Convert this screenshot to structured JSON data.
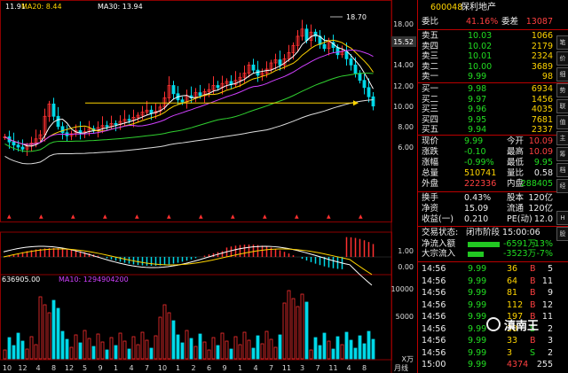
{
  "chart": {
    "ma_legend": {
      "ma1": "11.91",
      "ma20": "MA20: 8.44",
      "ma30": "MA30: 13.94"
    },
    "vol_legend": {
      "vol": "636905.00",
      "ma10": "MA10: 1294904200"
    },
    "price_axis": [
      "18.00",
      "16.00",
      "14.00",
      "12.00",
      "10.00",
      "8.00",
      "6.00"
    ],
    "price_marker": "15.52",
    "high_annotation": "18.70",
    "macd_axis": [
      "1.00",
      "0.00"
    ],
    "vol_axis": [
      "10000",
      "5000"
    ],
    "x_axis": [
      "10",
      "12",
      "4",
      "8",
      "12",
      "5",
      "9",
      "1",
      "4",
      "7",
      "10",
      "1",
      "2",
      "6",
      "9",
      "1",
      "4",
      "7",
      "11",
      "3",
      "7",
      "11",
      "4",
      "8"
    ],
    "x_unit": "月线",
    "vol_unit": "X万",
    "colors": {
      "up": "#ff3030",
      "down": "#00d8e8",
      "ma_white": "#ffffff",
      "ma_yellow": "#ffd400",
      "ma_purple": "#d040ff",
      "ma_green": "#30d030"
    }
  },
  "quote": {
    "code": "600048",
    "name": "保利地产",
    "weibi_label": "委比",
    "weibi": "41.16%",
    "weicha_label": "委差",
    "weicha": "13087",
    "sell": [
      {
        "label": "卖五",
        "price": "10.03",
        "vol": "1066"
      },
      {
        "label": "卖四",
        "price": "10.02",
        "vol": "2179"
      },
      {
        "label": "卖三",
        "price": "10.01",
        "vol": "2324"
      },
      {
        "label": "卖二",
        "price": "10.00",
        "vol": "3689"
      },
      {
        "label": "卖一",
        "price": "9.99",
        "vol": "98"
      }
    ],
    "buy": [
      {
        "label": "买一",
        "price": "9.98",
        "vol": "6934"
      },
      {
        "label": "买二",
        "price": "9.97",
        "vol": "1456"
      },
      {
        "label": "买三",
        "price": "9.96",
        "vol": "4035"
      },
      {
        "label": "买四",
        "price": "9.95",
        "vol": "7681"
      },
      {
        "label": "买五",
        "price": "9.94",
        "vol": "2337"
      }
    ],
    "stats": [
      {
        "l1": "现价",
        "v1": "9.99",
        "l2": "今开",
        "v2": "10.09"
      },
      {
        "l1": "涨跌",
        "v1": "-0.10",
        "l2": "最高",
        "v2": "10.09"
      },
      {
        "l1": "涨幅",
        "v1": "-0.99%",
        "l2": "最低",
        "v2": "9.95"
      },
      {
        "l1": "总量",
        "v1": "510741",
        "l2": "量比",
        "v2": "0.58"
      },
      {
        "l1": "外盘",
        "v1": "222336",
        "l2": "内盘",
        "v2": "288405"
      }
    ],
    "stats2": [
      {
        "l1": "换手",
        "v1": "0.43%",
        "l2": "股本",
        "v2": "120亿"
      },
      {
        "l1": "净资",
        "v1": "15.09",
        "l2": "流通",
        "v2": "120亿"
      },
      {
        "l1": "收益(一)",
        "v1": "0.210",
        "l2": "PE(动)",
        "v2": "12.0"
      }
    ],
    "status_label": "交易状态:",
    "status_value": "闭市阶段 15:00:06",
    "flows": [
      {
        "label": "净流入额",
        "value": "-6591万",
        "pct": "-13%"
      },
      {
        "label": "大宗流入",
        "value": "-3523万",
        "pct": "-7%"
      }
    ],
    "ticks": [
      {
        "t": "14:56",
        "p": "9.99",
        "v": "36",
        "d": "B",
        "n": "5"
      },
      {
        "t": "14:56",
        "p": "9.99",
        "v": "64",
        "d": "B",
        "n": "11"
      },
      {
        "t": "14:56",
        "p": "9.99",
        "v": "81",
        "d": "B",
        "n": "9"
      },
      {
        "t": "14:56",
        "p": "9.99",
        "v": "112",
        "d": "B",
        "n": "12"
      },
      {
        "t": "14:56",
        "p": "9.99",
        "v": "197",
        "d": "B",
        "n": "11"
      },
      {
        "t": "14:56",
        "p": "9.99",
        "v": "30",
        "d": "S",
        "n": "2"
      },
      {
        "t": "14:56",
        "p": "9.99",
        "v": "33",
        "d": "B",
        "n": "3"
      },
      {
        "t": "14:56",
        "p": "9.99",
        "v": "3",
        "d": "S",
        "n": "2"
      },
      {
        "t": "15:00",
        "p": "9.99",
        "v": "4374",
        "d": "",
        "n": "255"
      }
    ],
    "watermark": "滇南王"
  }
}
